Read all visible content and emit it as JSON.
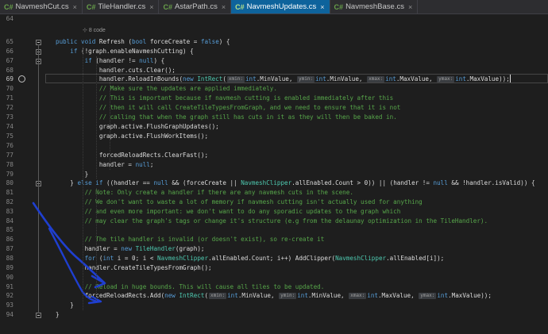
{
  "tabs": [
    {
      "icon": "C#",
      "name": "NavmeshCut.cs",
      "active": false
    },
    {
      "icon": "C#",
      "name": "TileHandler.cs",
      "active": false
    },
    {
      "icon": "C#",
      "name": "AstarPath.cs",
      "active": false
    },
    {
      "icon": "C#",
      "name": "NavmeshUpdates.cs",
      "active": true
    },
    {
      "icon": "C#",
      "name": "NavmeshBase.cs",
      "active": false
    }
  ],
  "tab_close_glyph": "×",
  "codelens": "8 code",
  "line_numbers": [
    "64",
    "65",
    "66",
    "67",
    "68",
    "69",
    "70",
    "71",
    "72",
    "73",
    "74",
    "75",
    "76",
    "77",
    "78",
    "79",
    "80",
    "81",
    "82",
    "83",
    "84",
    "85",
    "86",
    "87",
    "88",
    "89",
    "90",
    "91",
    "92",
    "93",
    "94"
  ],
  "current_line": "69",
  "code_lines": [
    [],
    [
      {
        "t": "kw",
        "s": "public void "
      },
      {
        "t": "tx",
        "s": "Refresh ("
      },
      {
        "t": "kw",
        "s": "bool "
      },
      {
        "t": "tx",
        "s": "forceCreate = "
      },
      {
        "t": "kw",
        "s": "false"
      },
      {
        "t": "tx",
        "s": ") {"
      }
    ],
    [
      {
        "t": "tx",
        "s": "    "
      },
      {
        "t": "kw",
        "s": "if "
      },
      {
        "t": "tx",
        "s": "(!graph.enableNavmeshCutting) {"
      }
    ],
    [
      {
        "t": "tx",
        "s": "        "
      },
      {
        "t": "kw",
        "s": "if "
      },
      {
        "t": "tx",
        "s": "(handler != "
      },
      {
        "t": "kw",
        "s": "null"
      },
      {
        "t": "tx",
        "s": ") {"
      }
    ],
    [
      {
        "t": "tx",
        "s": "            handler.cuts.Clear();"
      }
    ],
    [
      {
        "t": "tx",
        "s": "            handler.ReloadInBounds("
      },
      {
        "t": "kw",
        "s": "new "
      },
      {
        "t": "ty",
        "s": "IntRect"
      },
      {
        "t": "tx",
        "s": "("
      },
      {
        "t": "hint",
        "s": "xmin:"
      },
      {
        "t": "kw",
        "s": "int"
      },
      {
        "t": "tx",
        "s": ".MinValue, "
      },
      {
        "t": "hint",
        "s": "ymin:"
      },
      {
        "t": "kw",
        "s": "int"
      },
      {
        "t": "tx",
        "s": ".MinValue, "
      },
      {
        "t": "hint",
        "s": "xmax:"
      },
      {
        "t": "kw",
        "s": "int"
      },
      {
        "t": "tx",
        "s": ".MaxValue, "
      },
      {
        "t": "hint",
        "s": "ymax:"
      },
      {
        "t": "kw",
        "s": "int"
      },
      {
        "t": "tx",
        "s": ".MaxValue));"
      },
      {
        "t": "caret",
        "s": ""
      }
    ],
    [
      {
        "t": "tx",
        "s": "            "
      },
      {
        "t": "cm",
        "s": "// Make sure the updates are applied immediately."
      }
    ],
    [
      {
        "t": "tx",
        "s": "            "
      },
      {
        "t": "cm",
        "s": "// This is important because if navmesh cutting is enabled immediately after this"
      }
    ],
    [
      {
        "t": "tx",
        "s": "            "
      },
      {
        "t": "cm",
        "s": "// then it will call CreateTileTypesFromGraph, and we need to ensure that it is not"
      }
    ],
    [
      {
        "t": "tx",
        "s": "            "
      },
      {
        "t": "cm",
        "s": "// calling that when the graph still has cuts in it as they will then be baked in."
      }
    ],
    [
      {
        "t": "tx",
        "s": "            graph.active.FlushGraphUpdates();"
      }
    ],
    [
      {
        "t": "tx",
        "s": "            graph.active.FlushWorkItems();"
      }
    ],
    [],
    [
      {
        "t": "tx",
        "s": "            forcedReloadRects.ClearFast();"
      }
    ],
    [
      {
        "t": "tx",
        "s": "            handler = "
      },
      {
        "t": "kw",
        "s": "null"
      },
      {
        "t": "tx",
        "s": ";"
      }
    ],
    [
      {
        "t": "tx",
        "s": "        }"
      }
    ],
    [
      {
        "t": "tx",
        "s": "    } "
      },
      {
        "t": "kw",
        "s": "else if "
      },
      {
        "t": "tx",
        "s": "((handler == "
      },
      {
        "t": "kw",
        "s": "null"
      },
      {
        "t": "tx",
        "s": " && (forceCreate || "
      },
      {
        "t": "ty",
        "s": "NavmeshClipper"
      },
      {
        "t": "tx",
        "s": ".allEnabled.Count > 0)) || (handler != "
      },
      {
        "t": "kw",
        "s": "null"
      },
      {
        "t": "tx",
        "s": " && !handler.isValid)) {"
      }
    ],
    [
      {
        "t": "tx",
        "s": "        "
      },
      {
        "t": "cm",
        "s": "// Note: Only create a handler if there are any navmesh cuts in the scene."
      }
    ],
    [
      {
        "t": "tx",
        "s": "        "
      },
      {
        "t": "cm",
        "s": "// We don't want to waste a lot of memory if navmesh cutting isn't actually used for anything"
      }
    ],
    [
      {
        "t": "tx",
        "s": "        "
      },
      {
        "t": "cm",
        "s": "// and even more important: we don't want to do any sporadic updates to the graph which"
      }
    ],
    [
      {
        "t": "tx",
        "s": "        "
      },
      {
        "t": "cm",
        "s": "// may clear the graph's tags or change it's structure (e.g from the delaunay optimization in the TileHandler)."
      }
    ],
    [],
    [
      {
        "t": "tx",
        "s": "        "
      },
      {
        "t": "cm",
        "s": "// The tile handler is invalid (or doesn't exist), so re-create it"
      }
    ],
    [
      {
        "t": "tx",
        "s": "        handler = "
      },
      {
        "t": "kw",
        "s": "new "
      },
      {
        "t": "ty",
        "s": "TileHandler"
      },
      {
        "t": "tx",
        "s": "(graph);"
      }
    ],
    [
      {
        "t": "tx",
        "s": "        "
      },
      {
        "t": "kw",
        "s": "for "
      },
      {
        "t": "tx",
        "s": "("
      },
      {
        "t": "kw",
        "s": "int "
      },
      {
        "t": "tx",
        "s": "i = 0; i < "
      },
      {
        "t": "ty",
        "s": "NavmeshClipper"
      },
      {
        "t": "tx",
        "s": ".allEnabled.Count; i++) AddClipper("
      },
      {
        "t": "ty",
        "s": "NavmeshClipper"
      },
      {
        "t": "tx",
        "s": ".allEnabled[i]);"
      }
    ],
    [
      {
        "t": "tx",
        "s": "        handler.CreateTileTypesFromGraph();"
      }
    ],
    [],
    [
      {
        "t": "tx",
        "s": "        "
      },
      {
        "t": "cm",
        "s": "// Reload in huge bounds. This will cause all tiles to be updated."
      }
    ],
    [
      {
        "t": "tx",
        "s": "        forcedReloadRects.Add("
      },
      {
        "t": "kw",
        "s": "new "
      },
      {
        "t": "ty",
        "s": "IntRect"
      },
      {
        "t": "tx",
        "s": "("
      },
      {
        "t": "hint",
        "s": "xmin:"
      },
      {
        "t": "kw",
        "s": "int"
      },
      {
        "t": "tx",
        "s": ".MinValue, "
      },
      {
        "t": "hint",
        "s": "ymin:"
      },
      {
        "t": "kw",
        "s": "int"
      },
      {
        "t": "tx",
        "s": ".MinValue, "
      },
      {
        "t": "hint",
        "s": "xmax:"
      },
      {
        "t": "kw",
        "s": "int"
      },
      {
        "t": "tx",
        "s": ".MaxValue, "
      },
      {
        "t": "hint",
        "s": "ymax:"
      },
      {
        "t": "kw",
        "s": "int"
      },
      {
        "t": "tx",
        "s": ".MaxValue));"
      }
    ],
    [
      {
        "t": "tx",
        "s": "    }"
      }
    ],
    [
      {
        "t": "tx",
        "s": "}"
      }
    ]
  ],
  "colors": {
    "keyword": "#569cd6",
    "type": "#4ec9b0",
    "comment": "#57a64a",
    "text": "#dcdcdc",
    "active_tab": "#0e639c",
    "annotation": "#1f3fd0"
  }
}
